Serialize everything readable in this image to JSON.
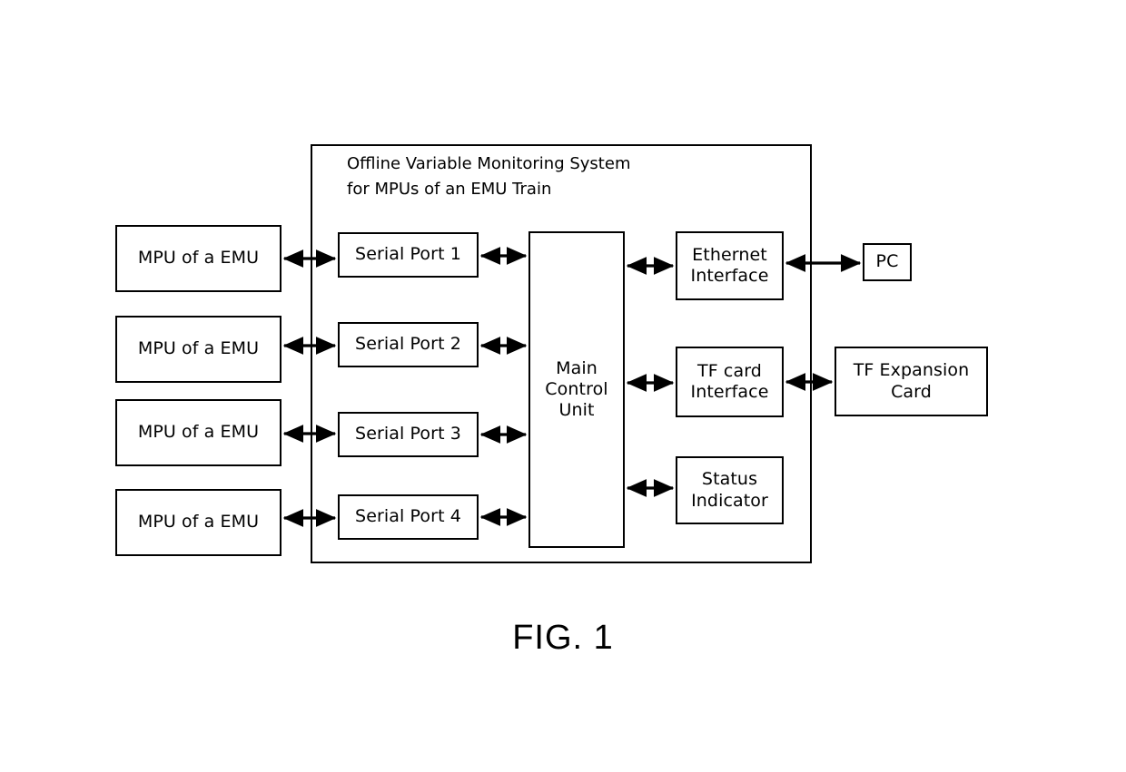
{
  "figure": {
    "caption": "FIG. 1",
    "system_title": "Offline Variable Monitoring System\nfor MPUs of an EMU Train"
  },
  "colors": {
    "stroke": "#000000",
    "fill": "#ffffff",
    "background": "#ffffff"
  },
  "nodes": {
    "mpus": [
      {
        "label": "MPU of a EMU"
      },
      {
        "label": "MPU of a EMU"
      },
      {
        "label": "MPU of a EMU"
      },
      {
        "label": "MPU of a EMU"
      }
    ],
    "serial_ports": [
      {
        "label": "Serial Port 1"
      },
      {
        "label": "Serial Port 2"
      },
      {
        "label": "Serial Port 3"
      },
      {
        "label": "Serial Port 4"
      }
    ],
    "main_control_unit": {
      "label": "Main\nControl\nUnit"
    },
    "ethernet_interface": {
      "label": "Ethernet\nInterface"
    },
    "tf_card_interface": {
      "label": "TF card\nInterface"
    },
    "status_indicator": {
      "label": "Status\nIndicator"
    },
    "pc": {
      "label": "PC"
    },
    "tf_expansion_card": {
      "label": "TF Expansion\nCard"
    }
  },
  "connections": [
    {
      "from": "MPU of a EMU",
      "to": "Serial Port 1",
      "arrow": "bidirectional"
    },
    {
      "from": "MPU of a EMU",
      "to": "Serial Port 2",
      "arrow": "bidirectional"
    },
    {
      "from": "MPU of a EMU",
      "to": "Serial Port 3",
      "arrow": "bidirectional"
    },
    {
      "from": "MPU of a EMU",
      "to": "Serial Port 4",
      "arrow": "bidirectional"
    },
    {
      "from": "Serial Port 1",
      "to": "Main Control Unit",
      "arrow": "bidirectional"
    },
    {
      "from": "Serial Port 2",
      "to": "Main Control Unit",
      "arrow": "bidirectional"
    },
    {
      "from": "Serial Port 3",
      "to": "Main Control Unit",
      "arrow": "bidirectional"
    },
    {
      "from": "Serial Port 4",
      "to": "Main Control Unit",
      "arrow": "bidirectional"
    },
    {
      "from": "Main Control Unit",
      "to": "Ethernet Interface",
      "arrow": "bidirectional"
    },
    {
      "from": "Main Control Unit",
      "to": "TF card Interface",
      "arrow": "bidirectional"
    },
    {
      "from": "Main Control Unit",
      "to": "Status Indicator",
      "arrow": "bidirectional"
    },
    {
      "from": "Ethernet Interface",
      "to": "PC",
      "arrow": "bidirectional"
    },
    {
      "from": "TF card Interface",
      "to": "TF Expansion Card",
      "arrow": "bidirectional"
    }
  ]
}
